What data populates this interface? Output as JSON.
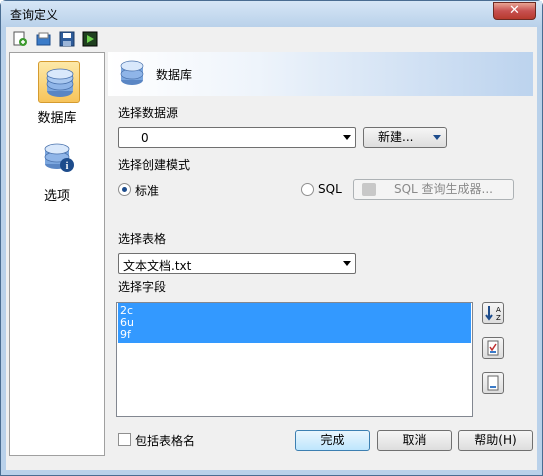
{
  "window": {
    "title": "查询定义",
    "close_label": "✕"
  },
  "toolbar": {
    "icons": [
      "new-query-icon",
      "open-icon",
      "save-icon",
      "run-icon"
    ]
  },
  "nav": {
    "items": [
      {
        "label": "数据库",
        "icon": "database-icon",
        "selected": true
      },
      {
        "label": "选项",
        "icon": "database-info-icon",
        "selected": false
      }
    ]
  },
  "banner": {
    "title": "数据库"
  },
  "datasource": {
    "label": "选择数据源",
    "value": "0",
    "new_button": "新建..."
  },
  "mode": {
    "label": "选择创建模式",
    "standard_label": "标准",
    "standard_checked": true,
    "sql_label": "SQL",
    "sql_checked": false,
    "builder_button": "SQL 查询生成器..."
  },
  "table": {
    "label": "选择表格",
    "value": "文本文档.txt"
  },
  "fields": {
    "label": "选择字段",
    "items": [
      "2c",
      "6u",
      "9f"
    ]
  },
  "include_table_name": {
    "label": "包括表格名",
    "checked": false
  },
  "buttons": {
    "finish": "完成",
    "cancel": "取消",
    "help": "帮助(H)"
  },
  "colors": {
    "selection": "#3399ff",
    "titlebar": "#b9d1ea",
    "close": "#c75050"
  }
}
